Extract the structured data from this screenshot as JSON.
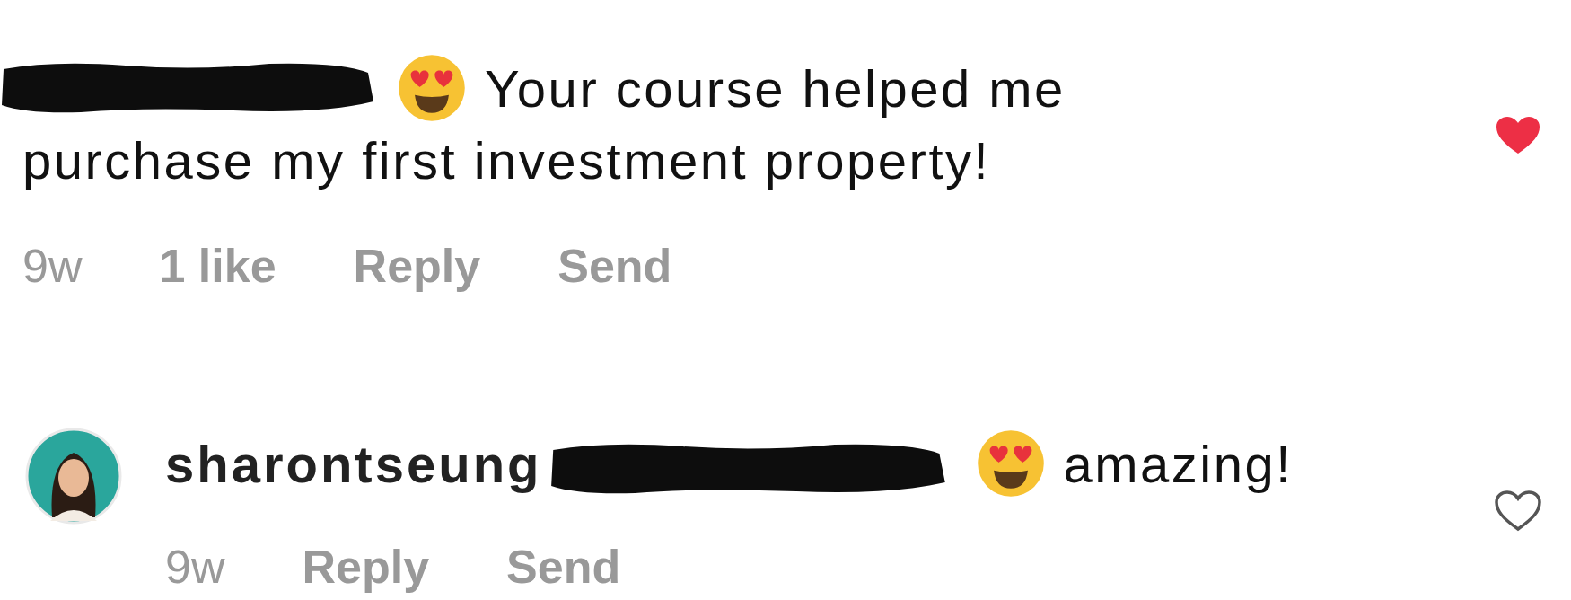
{
  "comments": [
    {
      "avatar": false,
      "lines": [
        [
          {
            "kind": "redaction"
          },
          {
            "kind": "emoji"
          },
          {
            "kind": "text",
            "text": "Your course helped me"
          }
        ],
        [
          {
            "kind": "text",
            "text": "purchase my first investment property!"
          }
        ]
      ],
      "time": "9w",
      "likes": "1 like",
      "actions": [
        "Reply",
        "Send"
      ],
      "liked": true
    },
    {
      "avatar": true,
      "lines": [
        [
          {
            "kind": "username",
            "text": "sharontseung"
          },
          {
            "kind": "redaction"
          },
          {
            "kind": "emoji"
          },
          {
            "kind": "text",
            "text": "amazing!"
          }
        ]
      ],
      "time": "9w",
      "actions": [
        "Reply",
        "Send"
      ],
      "liked": false
    }
  ]
}
